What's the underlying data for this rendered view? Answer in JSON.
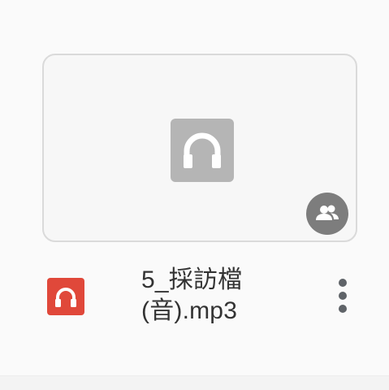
{
  "file": {
    "name_line1": "5_採訪檔",
    "name_line2": "(音).mp3",
    "type_icon": "audio-headphones-icon",
    "type_color": "#e0483a",
    "shared_icon": "people-icon"
  },
  "menu": {
    "more_icon": "more-vert-icon"
  }
}
